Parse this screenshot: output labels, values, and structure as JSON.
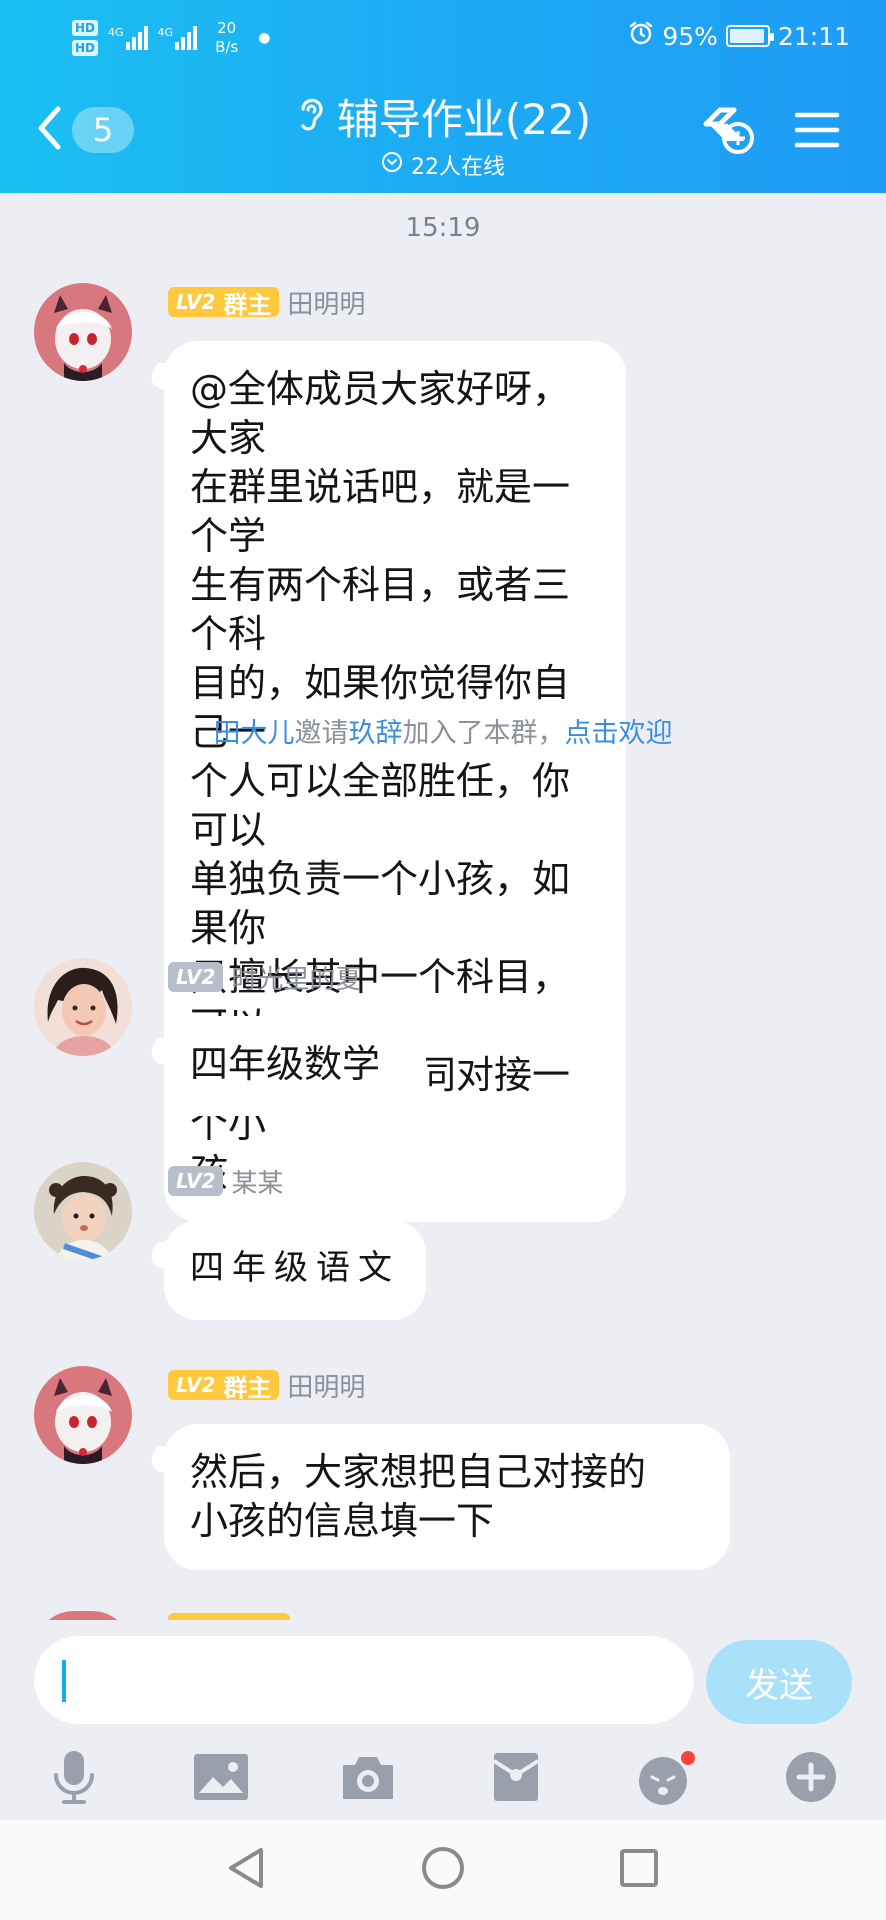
{
  "status_bar": {
    "hd1": "HD",
    "hd2": "HD",
    "net1": "4G",
    "net2": "4G",
    "speed_value": "20",
    "speed_unit": "B/s",
    "battery": "95%",
    "time": "21:11"
  },
  "header": {
    "back_count": "5",
    "title": "辅导作业(22)",
    "online": "22人在线"
  },
  "chat": {
    "timestamp": "15:19",
    "messages": [
      {
        "level": "LV2",
        "role": "群主",
        "sender": "田明明",
        "text": "@全体成员大家好呀，大家\n在群里说话吧，就是一个学\n生有两个科目，或者三个科\n目的，如果你觉得你自己一\n个人可以全部胜任，你可以\n单独负责一个小孩，如果你\n只擅长其中一个科目，可以\n同时和别人共同对接一个小\n孩"
      },
      {
        "level": "LV2",
        "sender": "时光里的夏",
        "text": "四年级数学"
      },
      {
        "level": "LV2",
        "sender": "某某",
        "text": "四年级语文"
      },
      {
        "level": "LV2",
        "role": "群主",
        "sender": "田明明",
        "text": "然后，大家想把自己对接的\n小孩的信息填一下"
      }
    ],
    "system_note": {
      "inviter": "田大儿",
      "verb": "邀请",
      "invitee": "玖辞",
      "tail": "加入了本群，",
      "action": "点击欢迎"
    }
  },
  "input": {
    "value": "",
    "send_label": "发送"
  },
  "icons": {
    "toolbar": [
      "microphone-icon",
      "image-icon",
      "camera-icon",
      "red-packet-icon",
      "emoji-icon",
      "plus-icon"
    ],
    "nav": [
      "back-triangle-icon",
      "home-circle-icon",
      "recents-square-icon"
    ]
  },
  "colors": {
    "header_gradient_start": "#1bc0f2",
    "header_gradient_end": "#1e9cf6",
    "owner_badge": "#ffc83d",
    "member_badge": "#b7bdca",
    "link": "#3a8ee0",
    "send_button": "#a9e1fb",
    "unread_dot": "#f5453d"
  }
}
